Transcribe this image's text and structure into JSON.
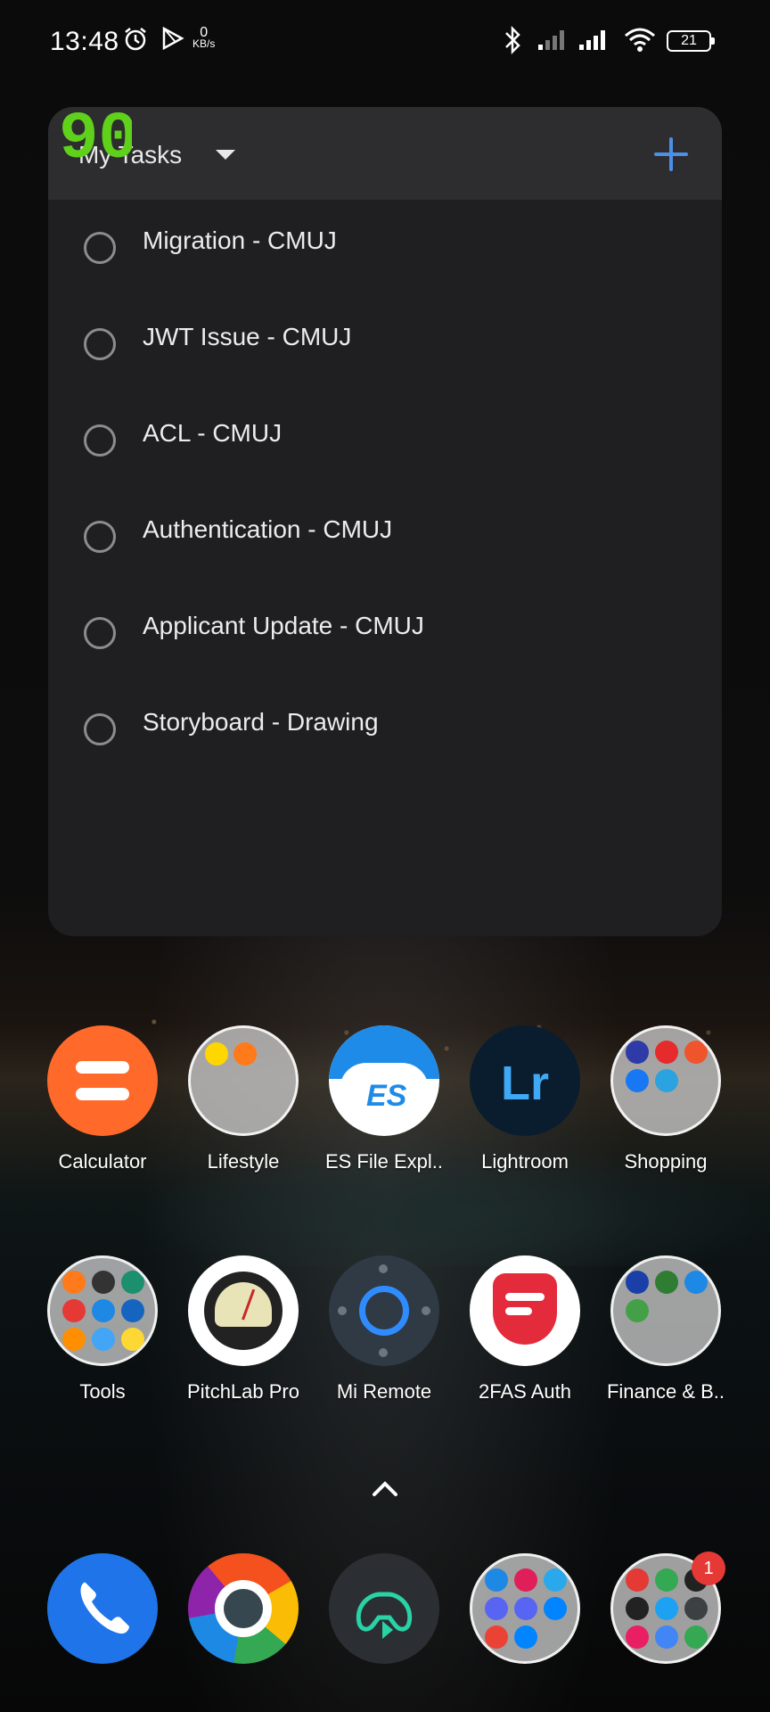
{
  "status_bar": {
    "time": "13:48",
    "net_speed_value": "0",
    "net_speed_unit": "KB/s",
    "battery_level": "21",
    "icons": [
      "alarm-icon",
      "play-store-icon",
      "bluetooth-icon",
      "signal-1-icon",
      "signal-2-icon",
      "wifi-icon",
      "battery-icon"
    ]
  },
  "overlay": {
    "counter": "90",
    "color": "#5fd11a"
  },
  "widget": {
    "title": "My Tasks",
    "add_icon": "plus-icon",
    "accent": "#4d8fe8",
    "tasks": [
      {
        "label": "Migration - CMUJ"
      },
      {
        "label": "JWT Issue - CMUJ"
      },
      {
        "label": "ACL - CMUJ"
      },
      {
        "label": "Authentication - CMUJ"
      },
      {
        "label": "Applicant Update - CMUJ"
      },
      {
        "label": "Storyboard - Drawing"
      }
    ]
  },
  "home": {
    "row1": [
      {
        "label": "Calculator",
        "icon": "calculator-icon"
      },
      {
        "label": "Lifestyle",
        "icon": "folder-icon"
      },
      {
        "label": "ES File Expl..",
        "icon": "es-file-explorer-icon"
      },
      {
        "label": "Lightroom",
        "icon": "lightroom-icon",
        "text": "Lr"
      },
      {
        "label": "Shopping",
        "icon": "folder-icon"
      }
    ],
    "row2": [
      {
        "label": "Tools",
        "icon": "folder-icon"
      },
      {
        "label": "PitchLab Pro",
        "icon": "pitchlab-icon"
      },
      {
        "label": "Mi Remote",
        "icon": "mi-remote-icon"
      },
      {
        "label": "2FAS Auth",
        "icon": "2fas-icon"
      },
      {
        "label": "Finance & B..",
        "icon": "folder-icon"
      }
    ],
    "drawer_icon": "chevron-up-icon"
  },
  "dock": {
    "items": [
      {
        "icon": "phone-icon"
      },
      {
        "icon": "browser-icon"
      },
      {
        "icon": "game-controller-icon"
      },
      {
        "icon": "social-folder-icon"
      },
      {
        "icon": "google-folder-icon"
      }
    ],
    "badge_count": "1"
  }
}
